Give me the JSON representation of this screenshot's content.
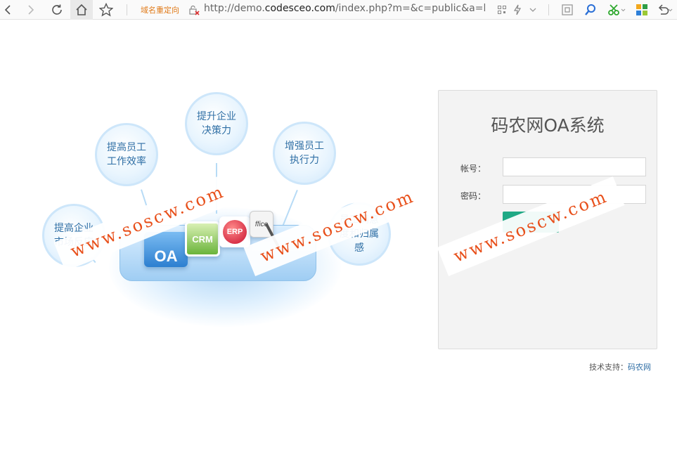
{
  "browser": {
    "redirect_label": "域名重定向",
    "url_prefix": "http://demo.",
    "url_host": "codesceo.com",
    "url_rest": "/index.php?m=&c=public&a=lo"
  },
  "illustration": {
    "bubbles": [
      "提高企业市场反应",
      "提高员工工作效率",
      "提升企业决策力",
      "增强员工执行力",
      "员工满意度和归属感"
    ],
    "boxes": {
      "oa": "OA",
      "crm": "CRM",
      "erp": "ERP",
      "office": "ffice"
    }
  },
  "login": {
    "title": "码农网OA系统",
    "account_label": "帐号：",
    "password_label": "密码：",
    "account_value": "",
    "password_value": ""
  },
  "footer": {
    "support_prefix": "技术支持：",
    "support_link": "码农网"
  },
  "watermark": {
    "text": "www.soscw.com",
    "color": "#e8501b"
  },
  "colors": {
    "accent_button": "#1fa985",
    "url_redirect": "#e07a18",
    "link": "#2e6da4"
  }
}
